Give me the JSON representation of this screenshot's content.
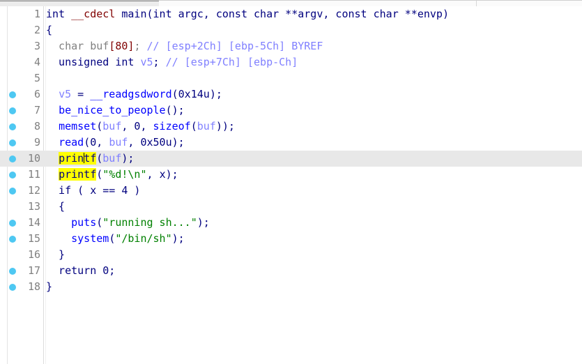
{
  "window": {
    "kind": "decompiler-pseudocode-view",
    "top_scrollbar": {
      "thumb_label": "horizontal-scroll-thumb"
    }
  },
  "editor": {
    "current_line": 10,
    "caret_line": 10,
    "caret_token": "printf",
    "caret_offset_in_token": 4,
    "search_highlight_term": "printf",
    "breakpoint_lines": [
      6,
      7,
      8,
      9,
      10,
      11,
      12,
      14,
      15,
      17,
      18
    ],
    "colors": {
      "background": "#ffffff",
      "current_line_highlight": "#e8e8e8",
      "search_highlight": "#ffff00",
      "breakpoint_dot": "#4ec8f2",
      "line_number": "#808080",
      "keyword": "#00007f",
      "function_call": "#0000ff",
      "declspec": "#800000",
      "type": "#808080",
      "local_variable": "#8080ff",
      "comment": "#8080ff",
      "string": "#008000",
      "number": "#800000"
    },
    "lines": [
      {
        "n": "1",
        "text": "int __cdecl main(int argc, const char **argv, const char **envp)"
      },
      {
        "n": "2",
        "text": "{"
      },
      {
        "n": "3",
        "text": "  char buf[80]; // [esp+2Ch] [ebp-5Ch] BYREF"
      },
      {
        "n": "4",
        "text": "  unsigned int v5; // [esp+7Ch] [ebp-Ch]"
      },
      {
        "n": "5",
        "text": ""
      },
      {
        "n": "6",
        "text": "  v5 = __readgsdword(0x14u);"
      },
      {
        "n": "7",
        "text": "  be_nice_to_people();"
      },
      {
        "n": "8",
        "text": "  memset(buf, 0, sizeof(buf));"
      },
      {
        "n": "9",
        "text": "  read(0, buf, 0x50u);"
      },
      {
        "n": "10",
        "text": "  printf(buf);"
      },
      {
        "n": "11",
        "text": "  printf(\"%d!\\n\", x);"
      },
      {
        "n": "12",
        "text": "  if ( x == 4 )"
      },
      {
        "n": "13",
        "text": "  {"
      },
      {
        "n": "14",
        "text": "    puts(\"running sh...\");"
      },
      {
        "n": "15",
        "text": "    system(\"/bin/sh\");"
      },
      {
        "n": "16",
        "text": "  }"
      },
      {
        "n": "17",
        "text": "  return 0;"
      },
      {
        "n": "18",
        "text": "}"
      }
    ]
  }
}
